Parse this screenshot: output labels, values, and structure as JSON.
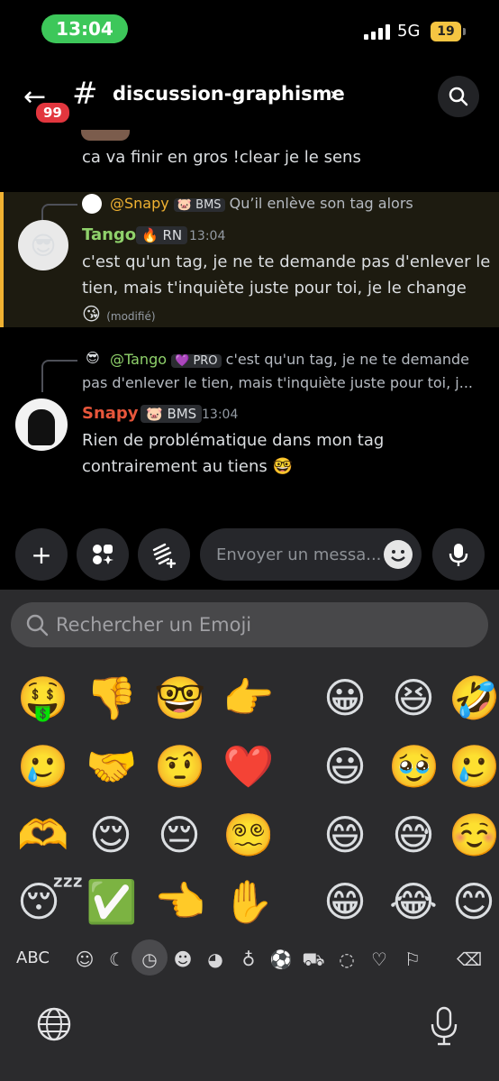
{
  "status": {
    "time": "13:04",
    "network": "5G",
    "battery": "19"
  },
  "header": {
    "unread_badge": "99",
    "channel": "discussion-graphisme"
  },
  "messages": {
    "prev_text": "ca va finir en gros !clear je le sens",
    "m1": {
      "reply_mention": "@Snapy",
      "reply_tag": "BMS",
      "reply_text": "Qu’il enlève son tag alors",
      "username": "Tango",
      "tag": "RN",
      "time": "13:04",
      "line1": "c'est qu'un tag, je ne te demande pas d'enlever le",
      "line2": "tien, mais t'inquiète juste pour toi, je le change",
      "emoji": "😘",
      "edited": "(modifié)"
    },
    "m2": {
      "reply_mention": "@Tango",
      "reply_tag": "PRO",
      "reply_line1": "c'est qu'un tag, je ne te demande",
      "reply_line2": "pas d'enlever le tien, mais t'inquiète juste pour toi, j...",
      "username": "Snapy",
      "tag": "BMS",
      "time": "13:04",
      "line1": "Rien de problématique dans mon tag",
      "line2": "contrairement au tiens",
      "emoji": "🤓"
    }
  },
  "composer": {
    "placeholder": "Envoyer un messa..."
  },
  "keyboard": {
    "search_placeholder": "Rechercher un Emoji",
    "recent": [
      "🤑",
      "👎",
      "🤓",
      "👉",
      "🥲",
      "🤝",
      "🤨",
      "❤️",
      "🫶",
      "😌",
      "😔",
      "😵‍💫",
      "😴",
      "✅",
      "👈",
      "✋"
    ],
    "smileys": [
      "😀",
      "😆",
      "🤣",
      "😃",
      "🥹",
      "🥲",
      "😄",
      "😅",
      "☺️",
      "😁",
      "😂",
      "😊"
    ],
    "abc_label": "ABC",
    "categories": [
      "face-icon",
      "moon-icon",
      "clock-icon",
      "smiley-icon",
      "dog-icon",
      "apple-icon",
      "soccer-icon",
      "car-icon",
      "bulb-icon",
      "heart-icon",
      "flag-icon",
      "backspace-icon"
    ]
  },
  "colors": {
    "tango": "#8fd16b",
    "snapy": "#e7563b",
    "mention": "#f0b232",
    "highlight_border": "#f0b232"
  }
}
